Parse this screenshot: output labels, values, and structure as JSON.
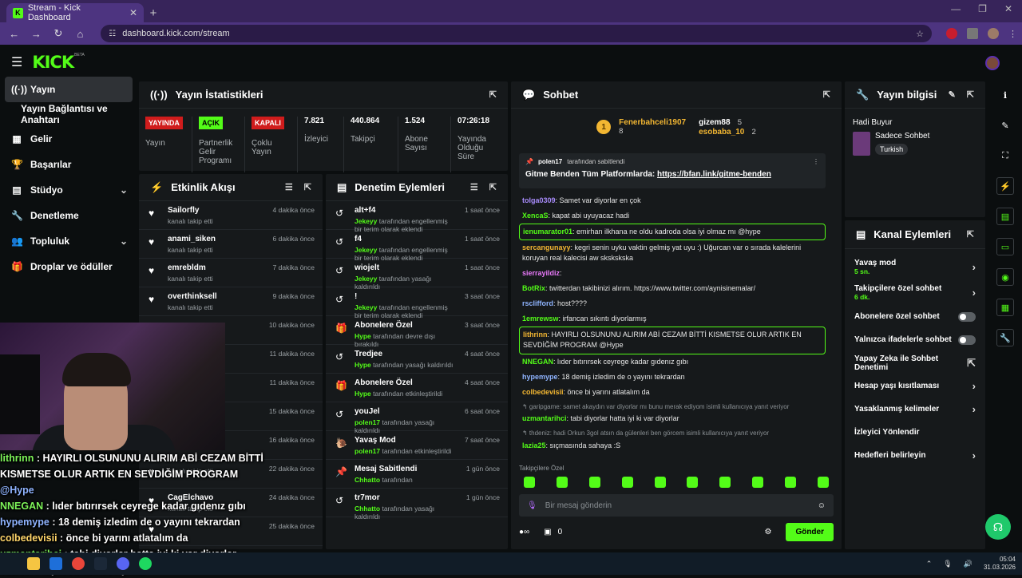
{
  "browser": {
    "tab_title": "Stream - Kick Dashboard",
    "tab_favicon": "K",
    "url": "dashboard.kick.com/stream"
  },
  "brand": {
    "logo": "KICK",
    "beta": "BETA",
    "accent": "#53fc18"
  },
  "sidebar": {
    "items": [
      {
        "label": "Yayın",
        "icon": "broadcast-icon",
        "glyph": "((·))"
      },
      {
        "label": "Yayın Bağlantısı ve Anahtarı"
      },
      {
        "label": "Gelir",
        "icon": "money-icon",
        "glyph": "▦"
      },
      {
        "label": "Başarılar",
        "icon": "trophy-icon",
        "glyph": "🏆"
      },
      {
        "label": "Stüdyo",
        "icon": "studio-icon",
        "glyph": "▤"
      },
      {
        "label": "Denetleme",
        "icon": "wrench-icon",
        "glyph": "🔧"
      },
      {
        "label": "Topluluk",
        "icon": "community-icon",
        "glyph": "👥"
      },
      {
        "label": "Droplar ve ödüller",
        "icon": "gift-icon",
        "glyph": "🎁"
      }
    ]
  },
  "stats": {
    "title": "Yayın İstatistikleri",
    "cells": [
      {
        "badge": "YAYINDA",
        "label": "Yayın"
      },
      {
        "badge": "AÇIK",
        "label": "Partnerlik Gelir Programı"
      },
      {
        "badge": "KAPALI",
        "label": "Çoklu Yayın"
      },
      {
        "value": "7.821",
        "label": "İzleyici"
      },
      {
        "value": "440.864",
        "label": "Takipçi"
      },
      {
        "value": "1.524",
        "label": "Abone Sayısı"
      },
      {
        "value": "07:26:18",
        "label": "Yayında Olduğu Süre"
      }
    ]
  },
  "activity": {
    "title": "Etkinlik Akışı",
    "items": [
      {
        "name": "Sailorfly",
        "sub": "kanalı takip etti",
        "time": "4 dakika önce"
      },
      {
        "name": "anami_siken",
        "sub": "kanalı takip etti",
        "time": "6 dakika önce"
      },
      {
        "name": "emrebldm",
        "sub": "kanalı takip etti",
        "time": "7 dakika önce"
      },
      {
        "name": "overthinksell",
        "sub": "kanalı takip etti",
        "time": "9 dakika önce"
      },
      {
        "name": "",
        "sub": "",
        "time": "10 dakika önce"
      },
      {
        "name": "",
        "sub": "",
        "time": "11 dakika önce"
      },
      {
        "name": "",
        "sub": "",
        "time": "11 dakika önce"
      },
      {
        "name": "",
        "sub": "",
        "time": "15 dakika önce"
      },
      {
        "name": "",
        "sub": "kanalı takip etti",
        "time": "16 dakika önce"
      },
      {
        "name": "",
        "sub": "kanalı takip etti",
        "time": "22 dakika önce"
      },
      {
        "name": "CagElchavo",
        "sub": "kanalı takip etti",
        "time": "24 dakika önce"
      },
      {
        "name": "",
        "sub": "",
        "time": "25 dakika önce"
      }
    ]
  },
  "moderation": {
    "title": "Denetim Eylemleri",
    "items": [
      {
        "title": "alt+f4",
        "actor": "Jekeyy",
        "rest": "tarafından engellenmiş bir terim olarak eklendi",
        "time": "1 saat önce",
        "icon": "history-icon",
        "glyph": "↺"
      },
      {
        "title": "f4",
        "actor": "Jekeyy",
        "rest": "tarafından engellenmiş bir terim olarak eklendi",
        "time": "1 saat önce",
        "icon": "history-icon",
        "glyph": "↺"
      },
      {
        "title": "wiojelt",
        "actor": "Jekeyy",
        "rest": "tarafından yasağı kaldırıldı",
        "time": "1 saat önce",
        "icon": "history-icon",
        "glyph": "↺"
      },
      {
        "title": "!",
        "actor": "Jekeyy",
        "rest": "tarafından engellenmiş bir terim olarak eklendi",
        "time": "3 saat önce",
        "icon": "history-icon",
        "glyph": "↺"
      },
      {
        "title": "Abonelere Özel",
        "actor": "Hype",
        "rest": "tarafından devre dışı bırakıldı",
        "time": "3 saat önce",
        "icon": "gift-icon",
        "glyph": "🎁"
      },
      {
        "title": "Tredjee",
        "actor": "Hype",
        "rest": "tarafından yasağı kaldırıldı",
        "time": "4 saat önce",
        "icon": "history-icon",
        "glyph": "↺"
      },
      {
        "title": "Abonelere Özel",
        "actor": "Hype",
        "rest": "tarafından etkinleştirildi",
        "time": "4 saat önce",
        "icon": "gift-icon",
        "glyph": "🎁"
      },
      {
        "title": "youJel",
        "actor": "polen17",
        "rest": "tarafından yasağı kaldırıldı",
        "time": "6 saat önce",
        "icon": "history-icon",
        "glyph": "↺"
      },
      {
        "title": "Yavaş Mod",
        "actor": "polen17",
        "rest": "tarafından etkinleştirildi",
        "time": "7 saat önce",
        "icon": "snail-icon",
        "glyph": "🐌"
      },
      {
        "title": "Mesaj Sabitlendi",
        "actor": "Chhatto",
        "rest": "tarafından",
        "time": "1 gün önce",
        "icon": "pin-icon",
        "glyph": "📌"
      },
      {
        "title": "tr7mor",
        "actor": "Chhatto",
        "rest": "tarafından yasağı kaldırıldı",
        "time": "1 gün önce",
        "icon": "history-icon",
        "glyph": "↺"
      }
    ]
  },
  "chat": {
    "title": "Sohbet",
    "leaders": [
      {
        "rank": "1",
        "name": "Fenerbahceli1907",
        "count": "8"
      },
      {
        "name": "gizem88",
        "count": "5"
      },
      {
        "name": "esobaba_10",
        "count": "2"
      }
    ],
    "pinned": {
      "user": "polen17",
      "meta": "tarafından sabitlendi",
      "text": "Gitme Benden Tüm Platformlarda:",
      "link": "https://bfan.link/gitme-benden"
    },
    "messages": [
      {
        "user": "tolga0309",
        "color": "#a78bfa",
        "text": ": Samet var diyorlar en çok"
      },
      {
        "user": "XencaS",
        "color": "#53fc18",
        "text": ": kapat abi uyuyacaz hadi"
      },
      {
        "user": "ienumarator01",
        "color": "#53fc18",
        "text": ": emirhan ilkhana ne oldu kadroda olsa iyi olmaz mı @hype",
        "hl": true
      },
      {
        "user": "sercangunayy",
        "color": "#f2b632",
        "text": ": kegri senin uyku vaktin gelmiş yat uyu :) Uğurcan var o sırada kalelerini koruyan real kalecisi aw skskskska"
      },
      {
        "user": "sierrayildiz",
        "color": "#e879f9",
        "text": ":"
      },
      {
        "user": "BotRix",
        "color": "#53fc18",
        "text": ": twitterdan takibinizi alırım. https://www.twitter.com/aynisinemalar/"
      },
      {
        "user": "rsclifford",
        "color": "#8fb4ff",
        "text": ": host????"
      },
      {
        "user": "1emrewsw",
        "color": "#53fc18",
        "text": ": irfancan sıkıntı diyorlarmış"
      },
      {
        "user": "lithrinn",
        "color": "#f2b632",
        "text": ": HAYIRLI OLSUNUNU ALIRIM ABİ CEZAM BİTTİ KISMETSE OLUR ARTIK EN SEVDİĞİM PROGRAM @Hype",
        "hl": true
      },
      {
        "user": "NNEGAN",
        "color": "#53fc18",
        "text": ": lıder bıtırırsek ceyrege kadar gıdenız gıbı"
      },
      {
        "user": "hypemype",
        "color": "#8fb4ff",
        "text": ": 18 demiş izledim de o yayını tekrardan"
      },
      {
        "user": "colbedevisii",
        "color": "#f2b632",
        "text": ": önce bi yarını atlatalım da"
      },
      {
        "user": "",
        "color": "#8a9094",
        "text": "↰ garipgame: samet akaydın var diyorlar mı bunu merak ediyom isimli kullanıcıya yanıt veriyor",
        "reply": true
      },
      {
        "user": "uzmantarihci",
        "color": "#53fc18",
        "text": ": tabi diyorlar hatta iyi ki var diyorlar"
      },
      {
        "user": "",
        "color": "#8a9094",
        "text": "↰ thdeniz: hadi Orkun 3gol atsın da gülenleri ben görcem isimli kullanıcıya yanıt veriyor",
        "reply": true
      },
      {
        "user": "lazia25",
        "color": "#53fc18",
        "text": ": sıçmasında sahaya :S"
      }
    ],
    "followers_only": "Takipçilere Özel",
    "placeholder": "Bir mesaj gönderin",
    "counter": "0",
    "send": "Gönder"
  },
  "streaminfo": {
    "title": "Yayın bilgisi",
    "stream_title": "Hadi Buyur",
    "category": "Sadece Sohbet",
    "tag": "Turkish"
  },
  "channel": {
    "title": "Kanal Eylemleri",
    "items": [
      {
        "label": "Yavaş mod",
        "sub": "5 sn.",
        "type": "chev"
      },
      {
        "label": "Takipçilere özel sohbet",
        "sub": "6 dk.",
        "type": "chev"
      },
      {
        "label": "Abonelere özel sohbet",
        "type": "toggle"
      },
      {
        "label": "Yalnızca ifadelerle sohbet",
        "type": "toggle"
      },
      {
        "label": "Yapay Zeka ile Sohbet Denetimi",
        "type": "ext"
      },
      {
        "label": "Hesap yaşı kısıtlaması",
        "type": "chev"
      },
      {
        "label": "Yasaklanmış kelimeler",
        "type": "chev"
      },
      {
        "label": "İzleyici Yönlendir",
        "type": "none"
      },
      {
        "label": "Hedefleri belirleyin",
        "type": "chev"
      }
    ]
  },
  "overlay": {
    "lines": [
      {
        "user": "lithrinn",
        "text": " : HAYIRLI OLSUNUNU ALIRIM ABİ CEZAM BİTTİ KISMETSE OLUR ARTIK EN SEVDİĞİM PROGRAM ",
        "mention": "@Hype",
        "cls": "ou-green"
      },
      {
        "user": "NNEGAN",
        "text": " : lıder bıtırırsek ceyrege kadar gıdenız gıbı",
        "cls": "ou-green"
      },
      {
        "user": "hypemype",
        "text": " : 18 demiş izledim de o yayını tekrardan",
        "cls": "ou-blue"
      },
      {
        "user": "colbedevisii",
        "text": " : önce bi yarını atlatalım da",
        "cls": "ou-yellow"
      },
      {
        "user": "uzmantarihci",
        "text": " : tabi diyorlar hatta iyi ki var diyorlar",
        "cls": "ou-green"
      },
      {
        "user": "lazia25",
        "text": " : sıçmasında sahaya :S",
        "cls": "ou-green"
      }
    ]
  },
  "taskbar": {
    "time": "05:04",
    "date": "31.03.2026"
  }
}
